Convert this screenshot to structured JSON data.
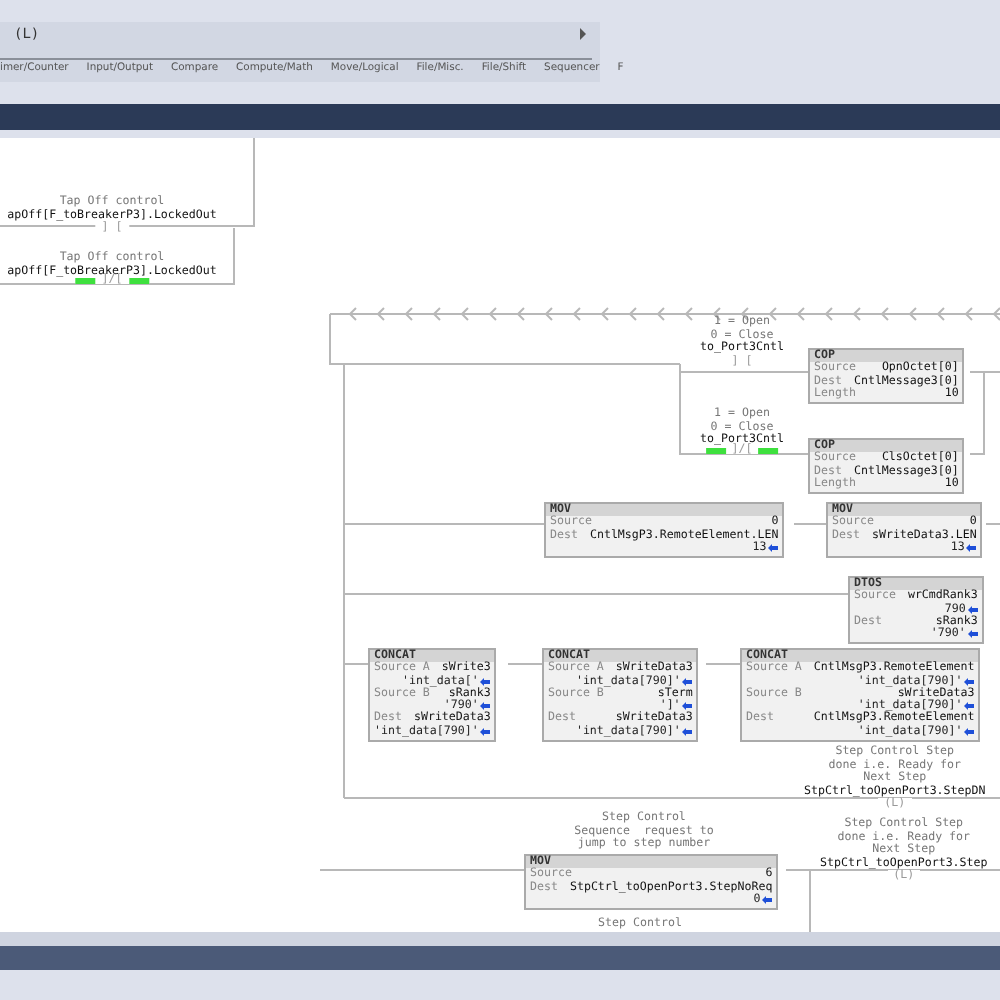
{
  "toolbar": {
    "instruction": "(L)",
    "categories": [
      "imer/Counter",
      "Input/Output",
      "Compare",
      "Compute/Math",
      "Move/Logical",
      "File/Misc.",
      "File/Shift",
      "Sequencer",
      "F"
    ]
  },
  "ladder": {
    "elements": [
      {
        "kind": "contact",
        "labels": [
          "Tap Off control"
        ],
        "tag": "apOff[F_toBreakerP3].LockedOut",
        "symbol": "] [",
        "energized": false
      },
      {
        "kind": "contact",
        "labels": [
          "Tap Off control"
        ],
        "tag": "apOff[F_toBreakerP3].LockedOut",
        "symbol": "]/[",
        "energized": true
      },
      {
        "kind": "contact",
        "labels": [
          "1 = Open",
          "0 = Close"
        ],
        "tag": "to_Port3Cntl",
        "symbol": "] [",
        "energized": false
      },
      {
        "kind": "instruction",
        "name": "COP",
        "rows": [
          {
            "label": "Source",
            "tag": "OpnOctet[0]"
          },
          {
            "label": "Dest",
            "tag": "CntlMessage3[0]"
          },
          {
            "label": "Length",
            "tag": "10"
          }
        ]
      },
      {
        "kind": "contact",
        "labels": [
          "1 = Open",
          "0 = Close"
        ],
        "tag": "to_Port3Cntl",
        "symbol": "]/[",
        "energized": true
      },
      {
        "kind": "instruction",
        "name": "COP",
        "rows": [
          {
            "label": "Source",
            "tag": "ClsOctet[0]"
          },
          {
            "label": "Dest",
            "tag": "CntlMessage3[0]"
          },
          {
            "label": "Length",
            "tag": "10"
          }
        ]
      },
      {
        "kind": "instruction",
        "name": "MOV",
        "rows": [
          {
            "label": "Source",
            "tag": "0"
          },
          {
            "label": "Dest",
            "tag": "CntlMsgP3.RemoteElement.LEN",
            "value": "13"
          }
        ]
      },
      {
        "kind": "instruction",
        "name": "MOV",
        "rows": [
          {
            "label": "Source",
            "tag": "0"
          },
          {
            "label": "Dest",
            "tag": "sWriteData3.LEN",
            "value": "13"
          }
        ]
      },
      {
        "kind": "instruction",
        "name": "DTOS",
        "rows": [
          {
            "label": "Source",
            "tag": "wrCmdRank3",
            "value": "790"
          },
          {
            "label": "Dest",
            "tag": "sRank3",
            "value": "'790'"
          }
        ]
      },
      {
        "kind": "instruction",
        "name": "CONCAT",
        "rows": [
          {
            "label": "Source A",
            "tag": "sWrite3",
            "value": "'int_data['"
          },
          {
            "label": "Source B",
            "tag": "sRank3",
            "value": "'790'"
          },
          {
            "label": "Dest",
            "tag": "sWriteData3",
            "value": "'int_data[790]'"
          }
        ]
      },
      {
        "kind": "instruction",
        "name": "CONCAT",
        "rows": [
          {
            "label": "Source A",
            "tag": "sWriteData3",
            "value": "'int_data[790]'"
          },
          {
            "label": "Source B",
            "tag": "sTerm",
            "value": "']'"
          },
          {
            "label": "Dest",
            "tag": "sWriteData3",
            "value": "'int_data[790]'"
          }
        ]
      },
      {
        "kind": "instruction",
        "name": "CONCAT",
        "rows": [
          {
            "label": "Source A",
            "tag": "CntlMsgP3.RemoteElement",
            "value": "'int_data[790]'"
          },
          {
            "label": "Source B",
            "tag": "sWriteData3",
            "value": "'int_data[790]'"
          },
          {
            "label": "Dest",
            "tag": "CntlMsgP3.RemoteElement",
            "value": "'int_data[790]'"
          }
        ]
      },
      {
        "kind": "coil",
        "labels": [
          "Step Control Step",
          "done i.e. Ready for",
          "Next Step"
        ],
        "tag": "StpCtrl_toOpenPort3.StepDN",
        "symbol": "(L)"
      },
      {
        "kind": "comment",
        "labels": [
          "Step Control",
          "Sequence  request to",
          "jump to step number"
        ]
      },
      {
        "kind": "instruction",
        "name": "MOV",
        "rows": [
          {
            "label": "Source",
            "tag": "6"
          },
          {
            "label": "Dest",
            "tag": "StpCtrl_toOpenPort3.StepNoReq",
            "value": "0"
          }
        ]
      },
      {
        "kind": "coil",
        "labels": [
          "Step Control Step",
          "done i.e. Ready for",
          "Next Step"
        ],
        "tag": "StpCtrl_toOpenPort3.Step",
        "symbol": "(L)"
      },
      {
        "kind": "comment",
        "labels": [
          "Step Control"
        ]
      }
    ]
  }
}
